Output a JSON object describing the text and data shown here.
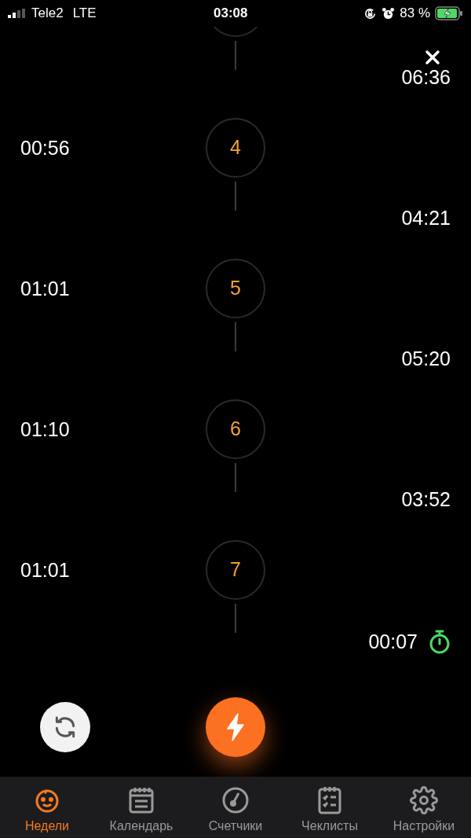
{
  "status_bar": {
    "carrier": "Tele2",
    "network": "LTE",
    "time": "03:08",
    "battery": "83 %"
  },
  "contractions": [
    {
      "number": "4",
      "duration": "00:56"
    },
    {
      "number": "5",
      "duration": "01:01"
    },
    {
      "number": "6",
      "duration": "01:10"
    },
    {
      "number": "7",
      "duration": "01:01"
    }
  ],
  "intervals": [
    {
      "value": "06:36",
      "running": false
    },
    {
      "value": "04:21",
      "running": false
    },
    {
      "value": "05:20",
      "running": false
    },
    {
      "value": "03:52",
      "running": false
    },
    {
      "value": "00:07",
      "running": true
    }
  ],
  "tabs": [
    {
      "label": "Недели",
      "selected": true
    },
    {
      "label": "Календарь",
      "selected": false
    },
    {
      "label": "Счетчики",
      "selected": false
    },
    {
      "label": "Чеклисты",
      "selected": false
    },
    {
      "label": "Настройки",
      "selected": false
    }
  ]
}
